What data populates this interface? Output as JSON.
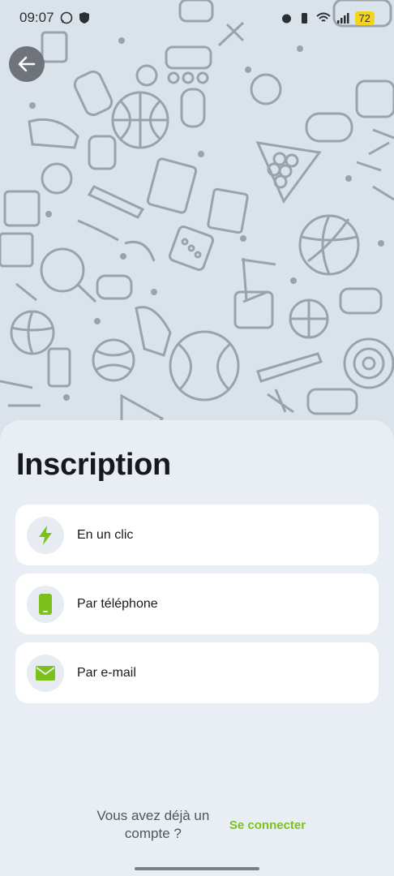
{
  "status_bar": {
    "time": "09:07",
    "battery": "72"
  },
  "title": "Inscription",
  "options": [
    {
      "label": "En un clic",
      "icon": "lightning-icon"
    },
    {
      "label": "Par téléphone",
      "icon": "phone-icon"
    },
    {
      "label": "Par e-mail",
      "icon": "mail-icon"
    }
  ],
  "footer": {
    "question": "Vous avez déjà un compte ?",
    "link": "Se connecter"
  },
  "colors": {
    "accent": "#7cc11b",
    "sheet_bg": "#e9eef5",
    "hero_bg": "#dbe3ea"
  }
}
